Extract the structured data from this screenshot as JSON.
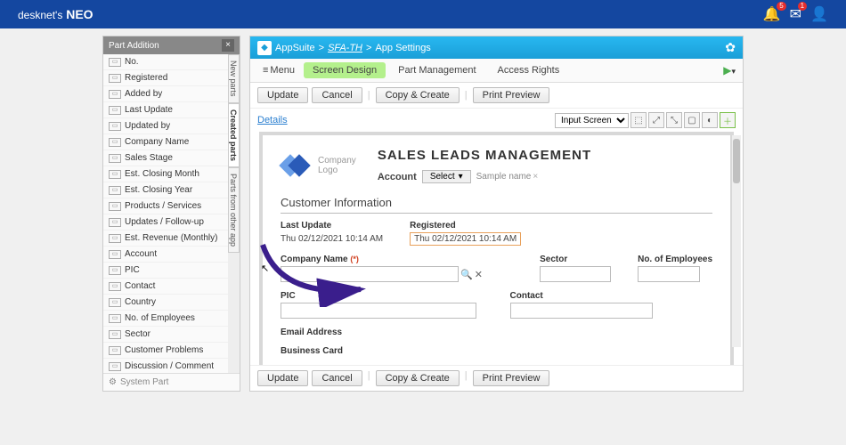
{
  "brand": {
    "name_prefix": "desknet's",
    "name_suffix": "NEO"
  },
  "topbar_badges": {
    "notif": "5",
    "msg": "1"
  },
  "part_panel": {
    "title": "Part Addition",
    "tabs": [
      "New parts",
      "Created parts",
      "Parts from other app"
    ],
    "active_tab": 1,
    "items": [
      "No.",
      "Registered",
      "Added by",
      "Last Update",
      "Updated by",
      "Company Name",
      "Sales Stage",
      "Est. Closing Month",
      "Est. Closing Year",
      "Products / Services",
      "Updates / Follow-up",
      "Est. Revenue (Monthly)",
      "Account",
      "PIC",
      "Contact",
      "Country",
      "No. of Employees",
      "Sector",
      "Customer Problems",
      "Discussion / Comment"
    ],
    "footer": "System Part"
  },
  "breadcrumb": {
    "app": "AppSuite",
    "mid": "SFA-TH",
    "tail": "App Settings"
  },
  "menu": {
    "menu_label": "Menu",
    "tabs": [
      "Screen Design",
      "Part Management",
      "Access Rights"
    ],
    "active": 0
  },
  "toolbar": {
    "update": "Update",
    "cancel": "Cancel",
    "copy": "Copy & Create",
    "print": "Print Preview",
    "details": "Details",
    "screen_select": "Input Screen"
  },
  "canvas": {
    "logo_text": "Company\nLogo",
    "title": "SALES LEADS MANAGEMENT",
    "account_label": "Account",
    "select_label": "Select",
    "sample_chip": "Sample name",
    "section_customer": "Customer Information",
    "last_update_label": "Last Update",
    "last_update_value": "Thu 02/12/2021 10:14 AM",
    "registered_label": "Registered",
    "registered_value": "Thu 02/12/2021 10:14 AM",
    "company_name_label": "Company Name",
    "req_marker": "(*)",
    "sector_label": "Sector",
    "employees_label": "No. of Employees",
    "pic_label": "PIC",
    "contact_label": "Contact",
    "email_label": "Email Address",
    "bcard_label": "Business Card"
  }
}
